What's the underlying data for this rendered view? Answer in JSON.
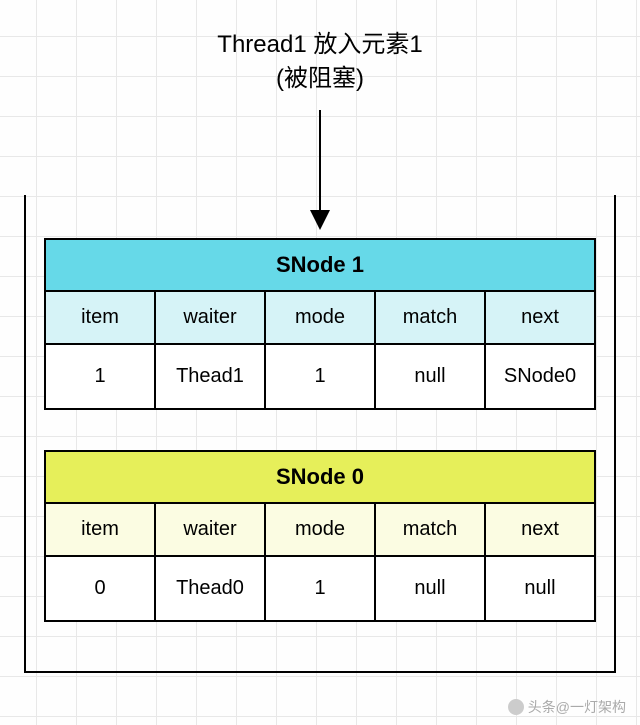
{
  "caption": {
    "line1": "Thread1 放入元素1",
    "line2": "(被阻塞)"
  },
  "nodes": [
    {
      "title": "SNode 1",
      "fields": [
        "item",
        "waiter",
        "mode",
        "match",
        "next"
      ],
      "values": [
        "1",
        "Thead1",
        "1",
        "null",
        "SNode0"
      ]
    },
    {
      "title": "SNode 0",
      "fields": [
        "item",
        "waiter",
        "mode",
        "match",
        "next"
      ],
      "values": [
        "0",
        "Thead0",
        "1",
        "null",
        "null"
      ]
    }
  ],
  "watermark": "头条@一灯架构",
  "chart_data": {
    "type": "table",
    "description": "SynchronousQueue stack snapshot when Thread1 pushes element 1 and gets blocked",
    "stack_top_to_bottom": [
      "SNode 1",
      "SNode 0"
    ],
    "columns": [
      "item",
      "waiter",
      "mode",
      "match",
      "next"
    ],
    "rows": [
      {
        "node": "SNode 1",
        "item": 1,
        "waiter": "Thead1",
        "mode": 1,
        "match": null,
        "next": "SNode0"
      },
      {
        "node": "SNode 0",
        "item": 0,
        "waiter": "Thead0",
        "mode": 1,
        "match": null,
        "next": null
      }
    ]
  }
}
